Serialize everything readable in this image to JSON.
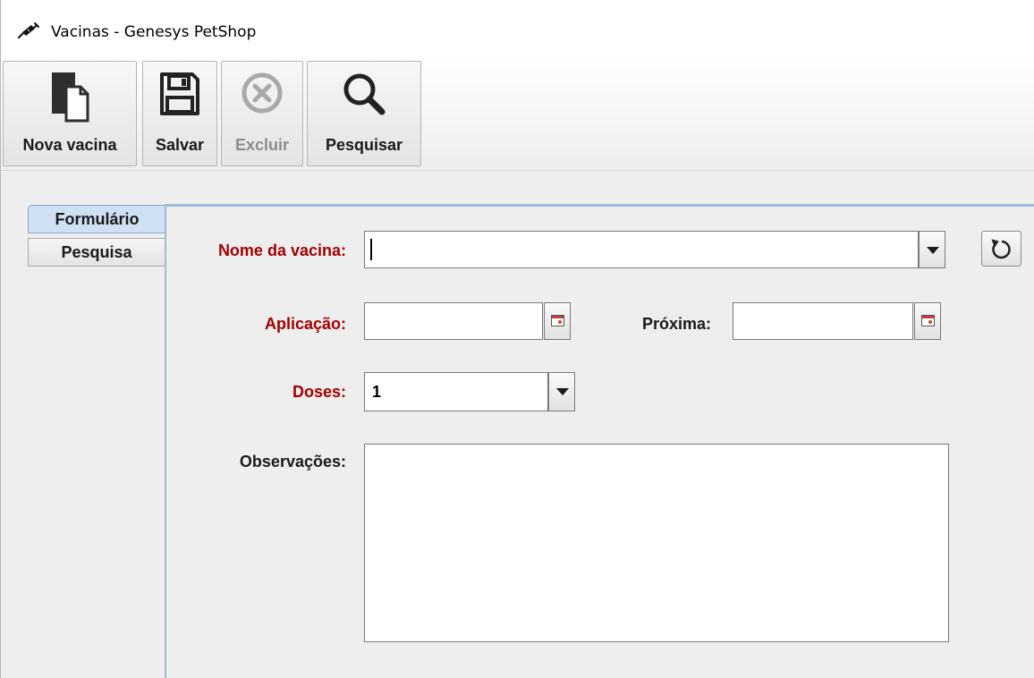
{
  "window": {
    "title": "Vacinas - Genesys PetShop",
    "icon": "syringe-icon"
  },
  "toolbar": {
    "buttons": [
      {
        "label": "Nova vacina",
        "icon": "new-document-icon",
        "enabled": true
      },
      {
        "label": "Salvar",
        "icon": "floppy-disk-icon",
        "enabled": true
      },
      {
        "label": "Excluir",
        "icon": "delete-x-icon",
        "enabled": false
      },
      {
        "label": "Pesquisar",
        "icon": "magnifier-icon",
        "enabled": true
      }
    ]
  },
  "tabs": [
    {
      "label": "Formulário",
      "active": true
    },
    {
      "label": "Pesquisa",
      "active": false
    }
  ],
  "form": {
    "nome_vacina": {
      "label": "Nome da vacina:",
      "value": "",
      "required": true
    },
    "aplicacao": {
      "label": "Aplicação:",
      "value": "",
      "required": true
    },
    "proxima": {
      "label": "Próxima:",
      "value": "",
      "required": false
    },
    "doses": {
      "label": "Doses:",
      "value": "1",
      "required": true
    },
    "observacoes": {
      "label": "Observações:",
      "value": "",
      "required": false
    }
  },
  "colors": {
    "required_label": "#a30000",
    "tab_active_bg": "#cfe0f5",
    "tab_border": "#9ebbdc"
  }
}
